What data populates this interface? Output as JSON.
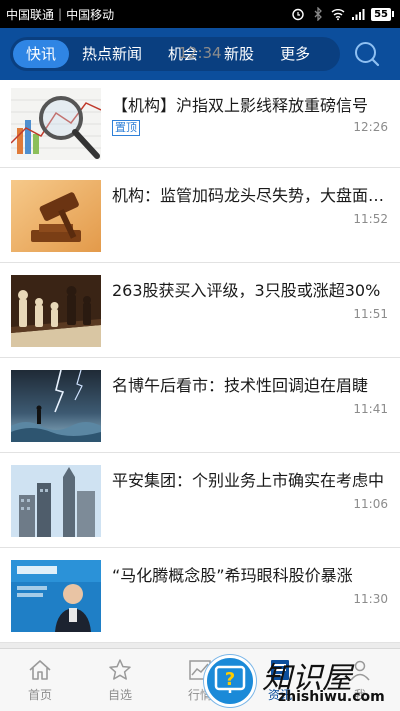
{
  "status_bar": {
    "carrier1": "中国联通",
    "carrier2": "中国移动",
    "time": "12:34",
    "battery": "55"
  },
  "nav": {
    "tabs": [
      {
        "label": "快讯",
        "active": true
      },
      {
        "label": "热点新闻",
        "active": false
      },
      {
        "label": "机会",
        "active": false
      },
      {
        "label": "新股",
        "active": false
      },
      {
        "label": "更多",
        "active": false
      }
    ]
  },
  "news": [
    {
      "title": "【机构】沪指双上影线释放重磅信号",
      "time": "12:26",
      "badge": "置顶",
      "thumb": "chart-magnifier"
    },
    {
      "title": "机构：监管加码龙头尽失势，大盘面临考验",
      "time": "11:52",
      "thumb": "gavel"
    },
    {
      "title": "263股获买入评级，3只股或涨超30%",
      "time": "11:51",
      "thumb": "chess"
    },
    {
      "title": "名博午后看市：技术性回调迫在眉睫",
      "time": "11:41",
      "thumb": "storm"
    },
    {
      "title": "平安集团：个别业务上市确实在考虑中",
      "time": "11:06",
      "thumb": "buildings"
    },
    {
      "title": "“马化腾概念股”希玛眼科股价暴涨",
      "time": "11:30",
      "thumb": "speaker"
    }
  ],
  "bottom_nav": {
    "items": [
      {
        "label": "首页",
        "icon": "home-icon"
      },
      {
        "label": "自选",
        "icon": "star-icon"
      },
      {
        "label": "行情",
        "icon": "chart-icon"
      },
      {
        "label": "资讯",
        "icon": "news-icon",
        "active": true
      },
      {
        "label": "我",
        "icon": "user-icon"
      }
    ]
  },
  "watermark": {
    "text": "知识屋",
    "url": "zhishiwu.com"
  },
  "colors": {
    "nav_bg": "#0c4e9c",
    "tab_active": "#2f85e4",
    "badge": "#2f80d8"
  }
}
